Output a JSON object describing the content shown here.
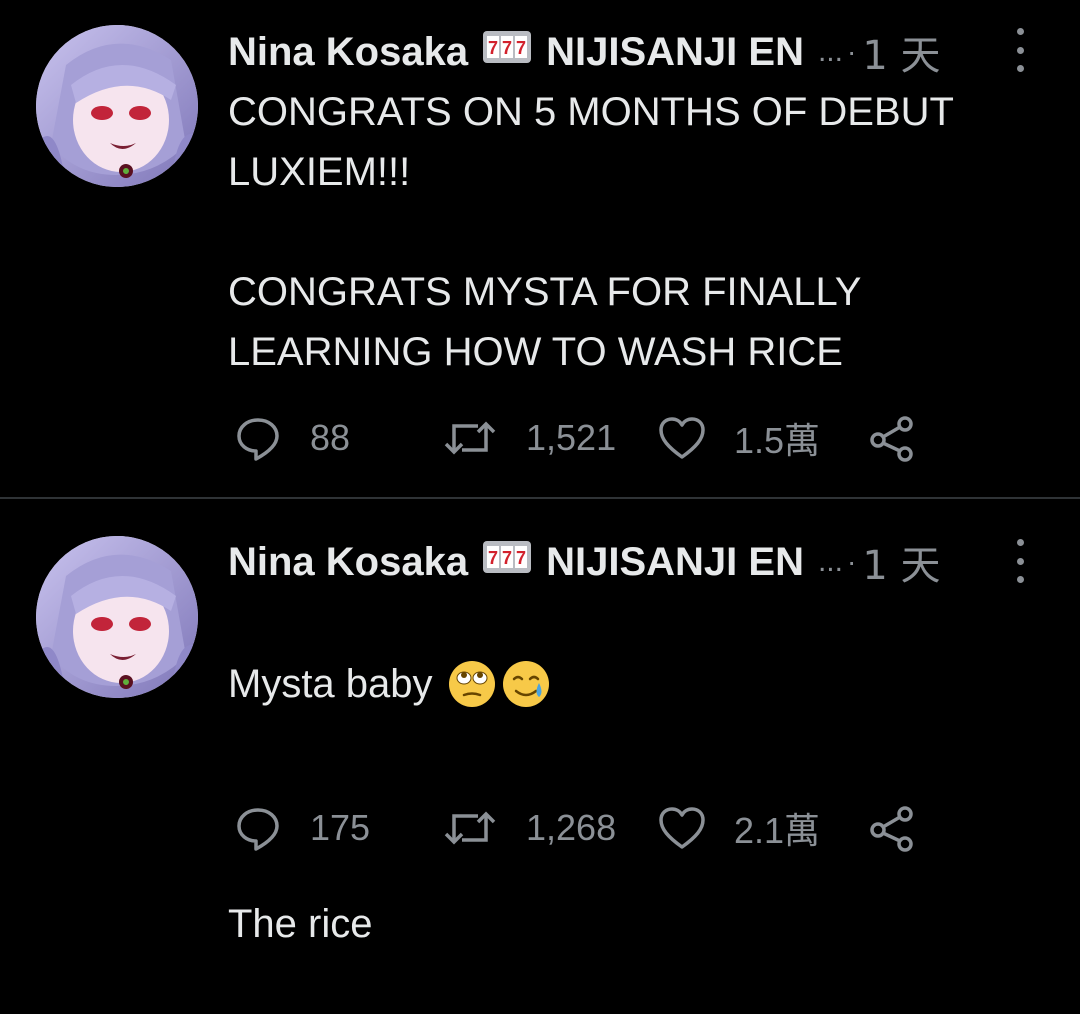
{
  "tweets": [
    {
      "author_name": "Nina Kosaka",
      "author_handle": "NIJISANJI EN",
      "ellipsis": "...",
      "separator": "·",
      "time": "1 天",
      "text": "CONGRATS ON 5 MONTHS OF DEBUT\nLUXIEM!!!\n\nCONGRATS MYSTA FOR FINALLY\nLEARNING HOW TO WASH RICE",
      "emojis": [],
      "replies": "88",
      "retweets": "1,521",
      "likes": "1.5萬"
    },
    {
      "author_name": "Nina Kosaka",
      "author_handle": "NIJISANJI EN",
      "ellipsis": "...",
      "separator": "·",
      "time": "1 天",
      "text_line1": "Mysta baby",
      "emojis": [
        "face-with-rolling-eyes",
        "smiling-face-with-tear"
      ],
      "text_line2": "The rice",
      "replies": "175",
      "retweets": "1,268",
      "likes": "2.1萬"
    }
  ],
  "colors": {
    "background": "#000000",
    "text": "#e7e9ea",
    "muted": "#8b9096",
    "divider": "#2f3336"
  },
  "icons": [
    "reply-icon",
    "retweet-icon",
    "like-icon",
    "share-icon",
    "more-icon",
    "slot-machine-icon"
  ]
}
